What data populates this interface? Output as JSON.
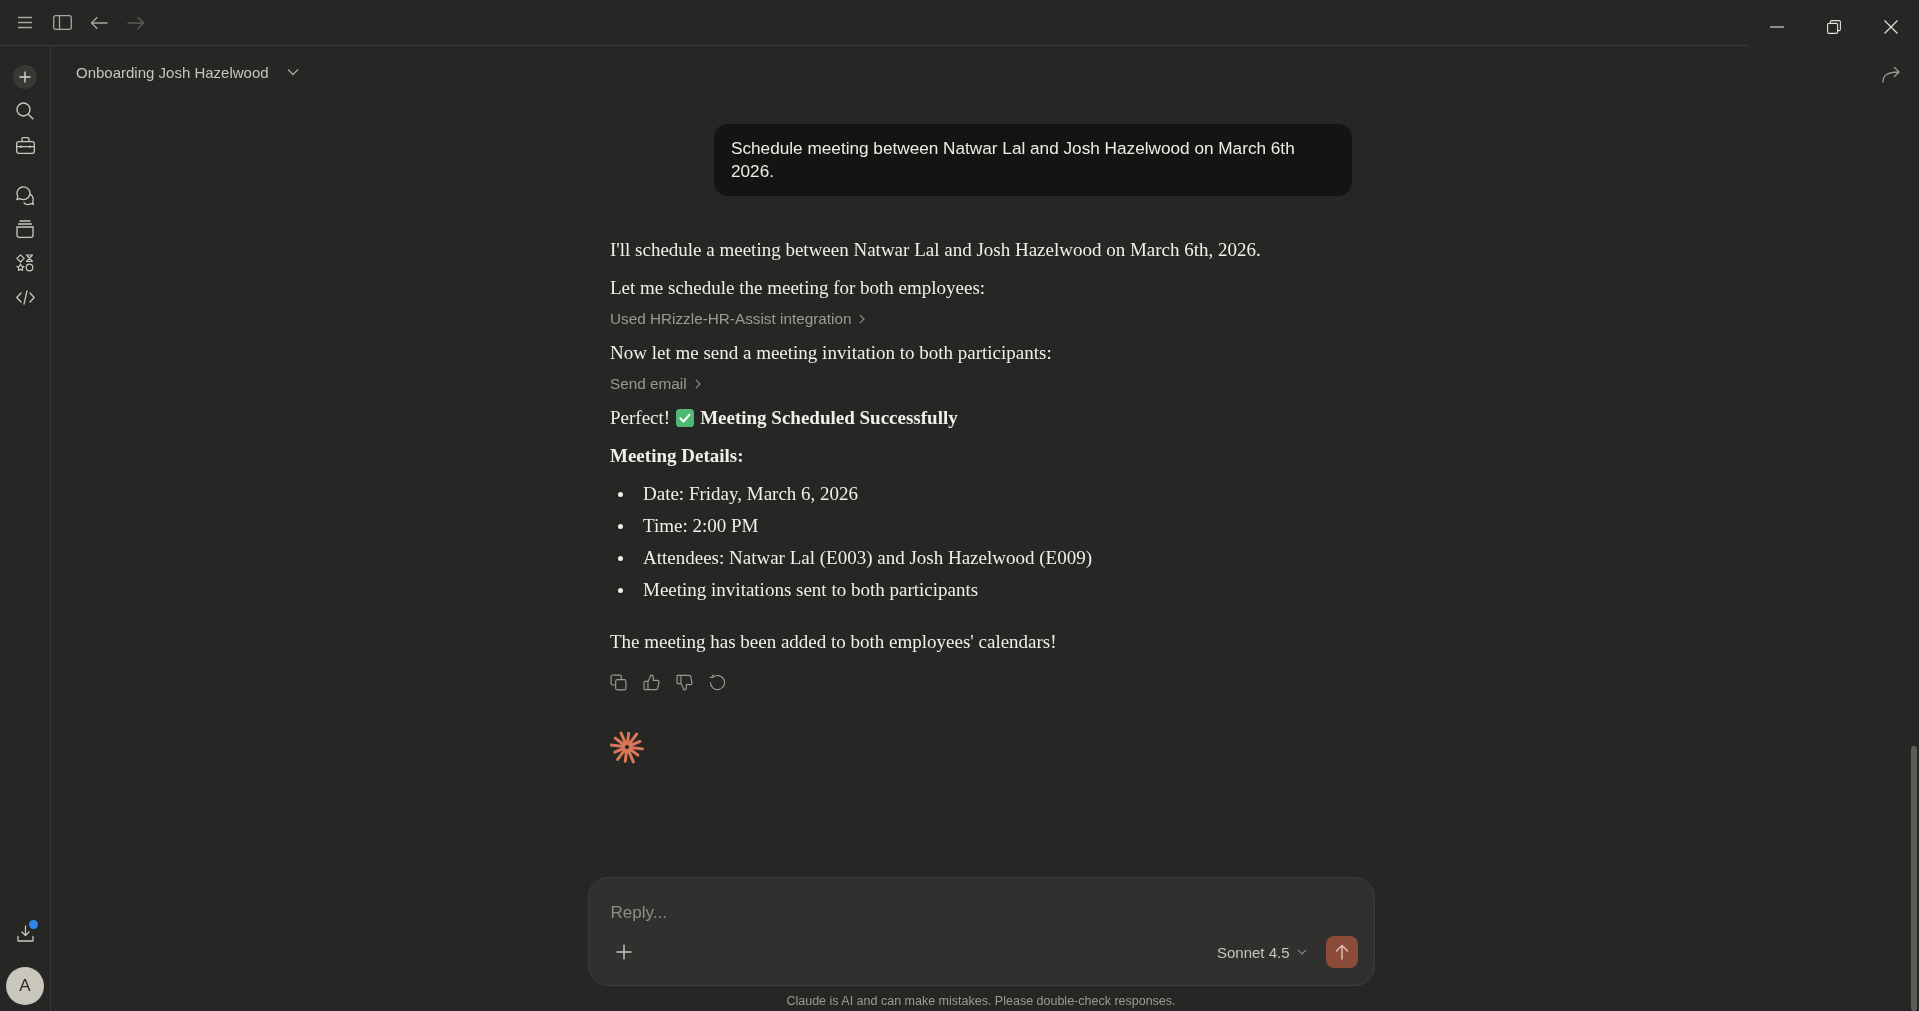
{
  "title_bar": {
    "navigation": [
      {
        "kind": "back",
        "disabled": false
      },
      {
        "kind": "forward",
        "disabled": true
      }
    ]
  },
  "sidebar": {
    "downloads": {
      "notification": true
    },
    "avatar": {
      "initial": "A"
    }
  },
  "conversation": {
    "title": "Onboarding Josh Hazelwood"
  },
  "messages": [
    {
      "kind": "prompt",
      "text": "Schedule meeting between Natwar Lal and Josh Hazelwood on March 6th 2026."
    },
    {
      "kind": "response",
      "blocks": [
        {
          "kind": "paragraph",
          "text": "I'll schedule a meeting between Natwar Lal and Josh Hazelwood on March 6th, 2026."
        },
        {
          "kind": "paragraph",
          "text": "Let me schedule the meeting for both employees:"
        },
        {
          "kind": "tool",
          "text": "Used HRizzle-HR-Assist integration"
        },
        {
          "kind": "paragraph",
          "text": "Now let me send a meeting invitation to both participants:"
        },
        {
          "kind": "tool",
          "text": "Send email"
        },
        {
          "kind": "success",
          "lead": "Perfect!",
          "title": "Meeting Scheduled Successfully"
        },
        {
          "kind": "heading",
          "text": "Meeting Details:"
        },
        {
          "kind": "list",
          "items": [
            "Date: Friday, March 6, 2026",
            "Time: 2:00 PM",
            "Attendees: Natwar Lal (E003) and Josh Hazelwood (E009)",
            "Meeting invitations sent to both participants"
          ]
        },
        {
          "kind": "paragraph",
          "text": "The meeting has been added to both employees' calendars!"
        }
      ]
    }
  ],
  "composer": {
    "placeholder": "Reply...",
    "model": "Sonnet 4.5",
    "send": {
      "disabled": true
    }
  },
  "disclaimer": "Claude is AI and can make mistakes. Please double-check responses."
}
